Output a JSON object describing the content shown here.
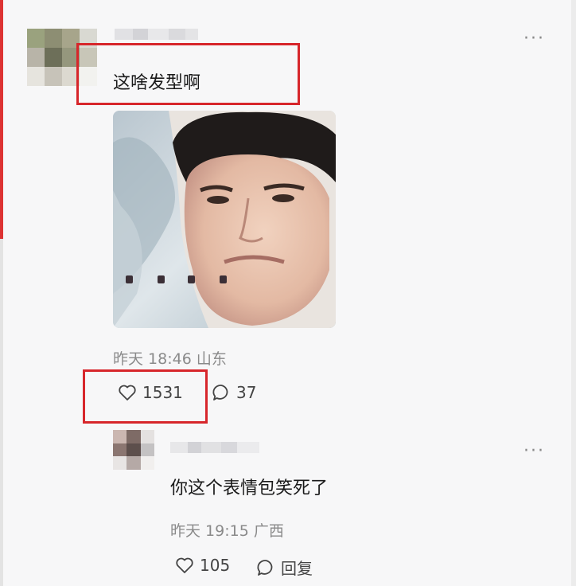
{
  "comment": {
    "text": "这啥发型啊",
    "time": "昨天 18:46",
    "location": "山东",
    "likes": "1531",
    "comments": "37",
    "more_label": "···"
  },
  "reply": {
    "text": "你这个表情包笑死了",
    "time": "昨天 19:15",
    "location": "广西",
    "likes": "105",
    "reply_label": "回复",
    "more_label": "···"
  },
  "colors": {
    "highlight": "#d7262b",
    "meta_text": "#8a8a8a"
  },
  "icons": {
    "like": "heart-outline-icon",
    "comment": "speech-bubble-icon",
    "more": "ellipsis-icon"
  }
}
